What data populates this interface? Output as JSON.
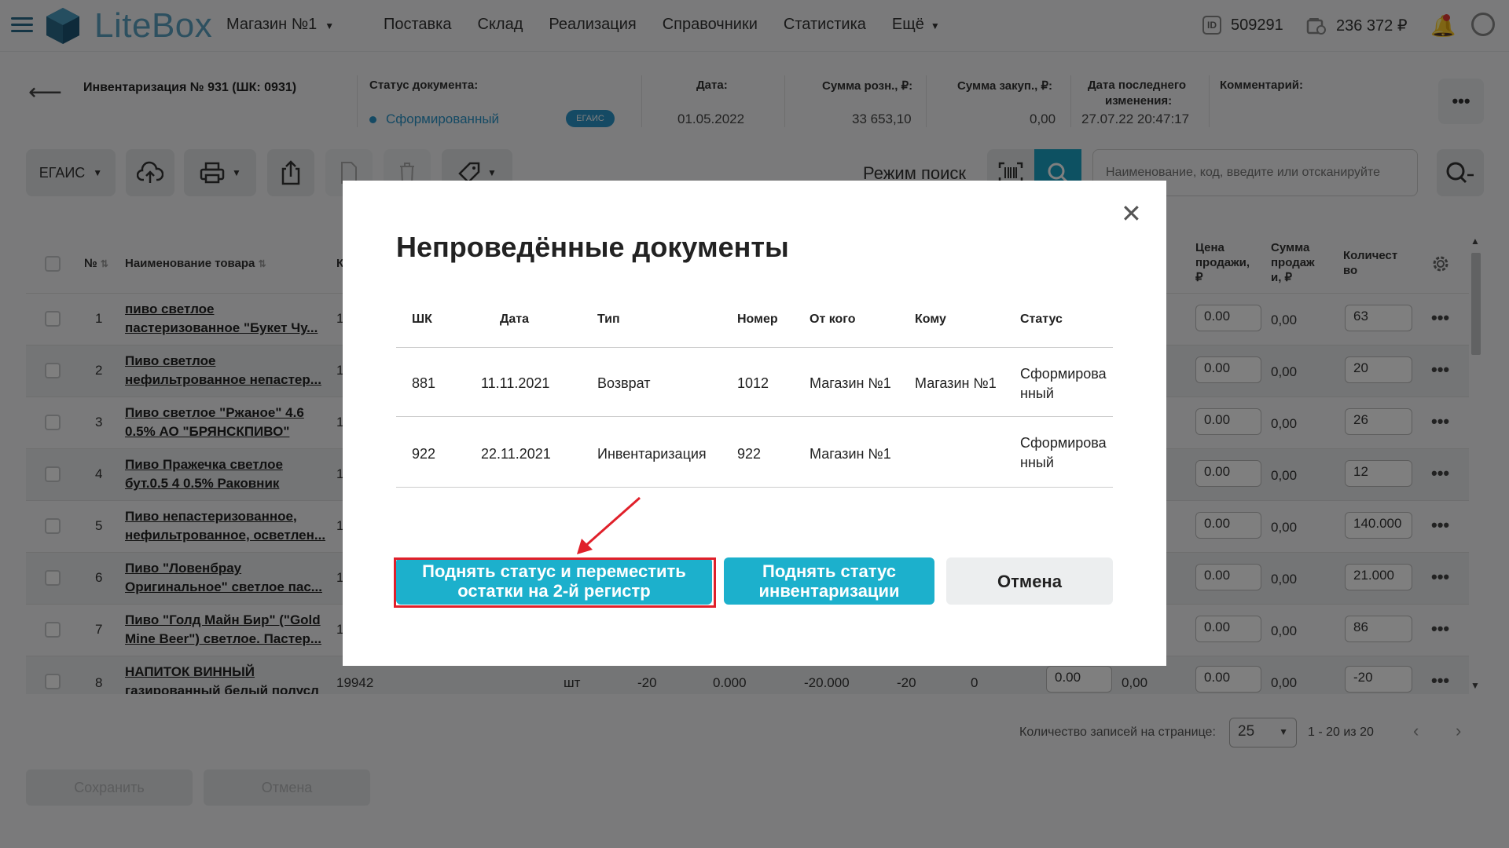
{
  "nav": {
    "logo": "LiteBox",
    "store": "Магазин №1",
    "menu": [
      "Поставка",
      "Склад",
      "Реализация",
      "Справочники",
      "Статистика",
      "Ещё"
    ],
    "user_id_badge": "ID",
    "user_id": "509291",
    "balance": "236 372 ₽"
  },
  "doc": {
    "title": "Инвентаризация № 931 (ШК: 0931)",
    "status_label": "Статус документа:",
    "status_value": "Сформированный",
    "egais_badge": "ЕГАИС",
    "date_label": "Дата:",
    "date_value": "01.05.2022",
    "retail_sum_label": "Сумма розн., ₽:",
    "retail_sum_value": "33 653,10",
    "purchase_sum_label": "Сумма закуп., ₽:",
    "purchase_sum_value": "0,00",
    "last_change_label_1": "Дата последнего",
    "last_change_label_2": "изменения:",
    "last_change_value": "27.07.22 20:47:17",
    "comment_label": "Комментарий:"
  },
  "toolbar": {
    "egais_label": "ЕГАИС",
    "mode_label": "Режим поиск",
    "search_placeholder": "Наименование, код, введите или отсканируйте"
  },
  "table": {
    "headers": {
      "num": "№",
      "name": "Наименование товара",
      "price_1": "Цена",
      "price_2": "продажи,",
      "price_3": "₽",
      "sum_1": "Сумма",
      "sum_2": "продаж",
      "sum_3": "и, ₽",
      "qty_1": "Количест",
      "qty_2": "во"
    },
    "rows": [
      {
        "n": "1",
        "name1": "пиво светлое",
        "name2": "пастеризованное \"Букет Чу...",
        "price": "0.00",
        "sum": "0,00",
        "qty": "63"
      },
      {
        "n": "2",
        "name1": "Пиво светлое",
        "name2": "нефильтрованное непастер...",
        "price": "0.00",
        "sum": "0,00",
        "qty": "20"
      },
      {
        "n": "3",
        "name1": "Пиво светлое \"Ржаное\" 4.6",
        "name2": "0.5% АО \"БРЯНСКПИВО\"",
        "price": "0.00",
        "sum": "0,00",
        "qty": "26"
      },
      {
        "n": "4",
        "name1": "Пиво Пражечка светлое",
        "name2": "бут.0.5 4 0.5% Раковник",
        "price": "0.00",
        "sum": "0,00",
        "qty": "12"
      },
      {
        "n": "5",
        "name1": "Пиво непастеризованное,",
        "name2": "нефильтрованное, осветлен...",
        "price": "0.00",
        "sum": "0,00",
        "qty": "140.000"
      },
      {
        "n": "6",
        "name1": "Пиво \"Ловенбрау",
        "name2": "Оригинальное\" светлое пас...",
        "price": "0.00",
        "sum": "0,00",
        "qty": "21.000"
      },
      {
        "n": "7",
        "name1": "Пиво \"Голд Майн Бир\" (\"Gold",
        "name2": "Mine Beer\") светлое. Пастер...",
        "price": "0.00",
        "sum": "0,00",
        "qty": "86"
      },
      {
        "n": "8",
        "name1": "НАПИТОК ВИННЫЙ",
        "name2": "газированный белый полусл",
        "code": "19942",
        "unit": "шт",
        "c1": "-20",
        "c2": "0.000",
        "c3": "-20.000",
        "c4": "-20",
        "c5": "0",
        "cost": "0.00",
        "cost_sum": "0,00",
        "price": "0.00",
        "sum": "0,00",
        "qty": "-20"
      }
    ],
    "row_code_prefix": "1"
  },
  "pagination": {
    "per_page_label": "Количество записей на странице:",
    "per_page": "25",
    "range": "1 - 20 из 20"
  },
  "bottom": {
    "save": "Сохранить",
    "cancel": "Отмена"
  },
  "modal": {
    "title": "Непроведённые документы",
    "columns": [
      "ШК",
      "Дата",
      "Тип",
      "Номер",
      "От кого",
      "Кому",
      "Статус"
    ],
    "rows": [
      {
        "sk": "881",
        "date": "11.11.2021",
        "type": "Возврат",
        "num": "1012",
        "from": "Магазин №1",
        "to": "Магазин №1",
        "status1": "Сформирова",
        "status2": "нный"
      },
      {
        "sk": "922",
        "date": "22.11.2021",
        "type": "Инвентаризация",
        "num": "922",
        "from": "Магазин №1",
        "to": "",
        "status1": "Сформирова",
        "status2": "нный"
      }
    ],
    "btn_move_1": "Поднять статус и переместить",
    "btn_move_2": "остатки на 2-й регистр",
    "btn_raise_1": "Поднять статус",
    "btn_raise_2": "инвентаризации",
    "btn_cancel": "Отмена"
  }
}
